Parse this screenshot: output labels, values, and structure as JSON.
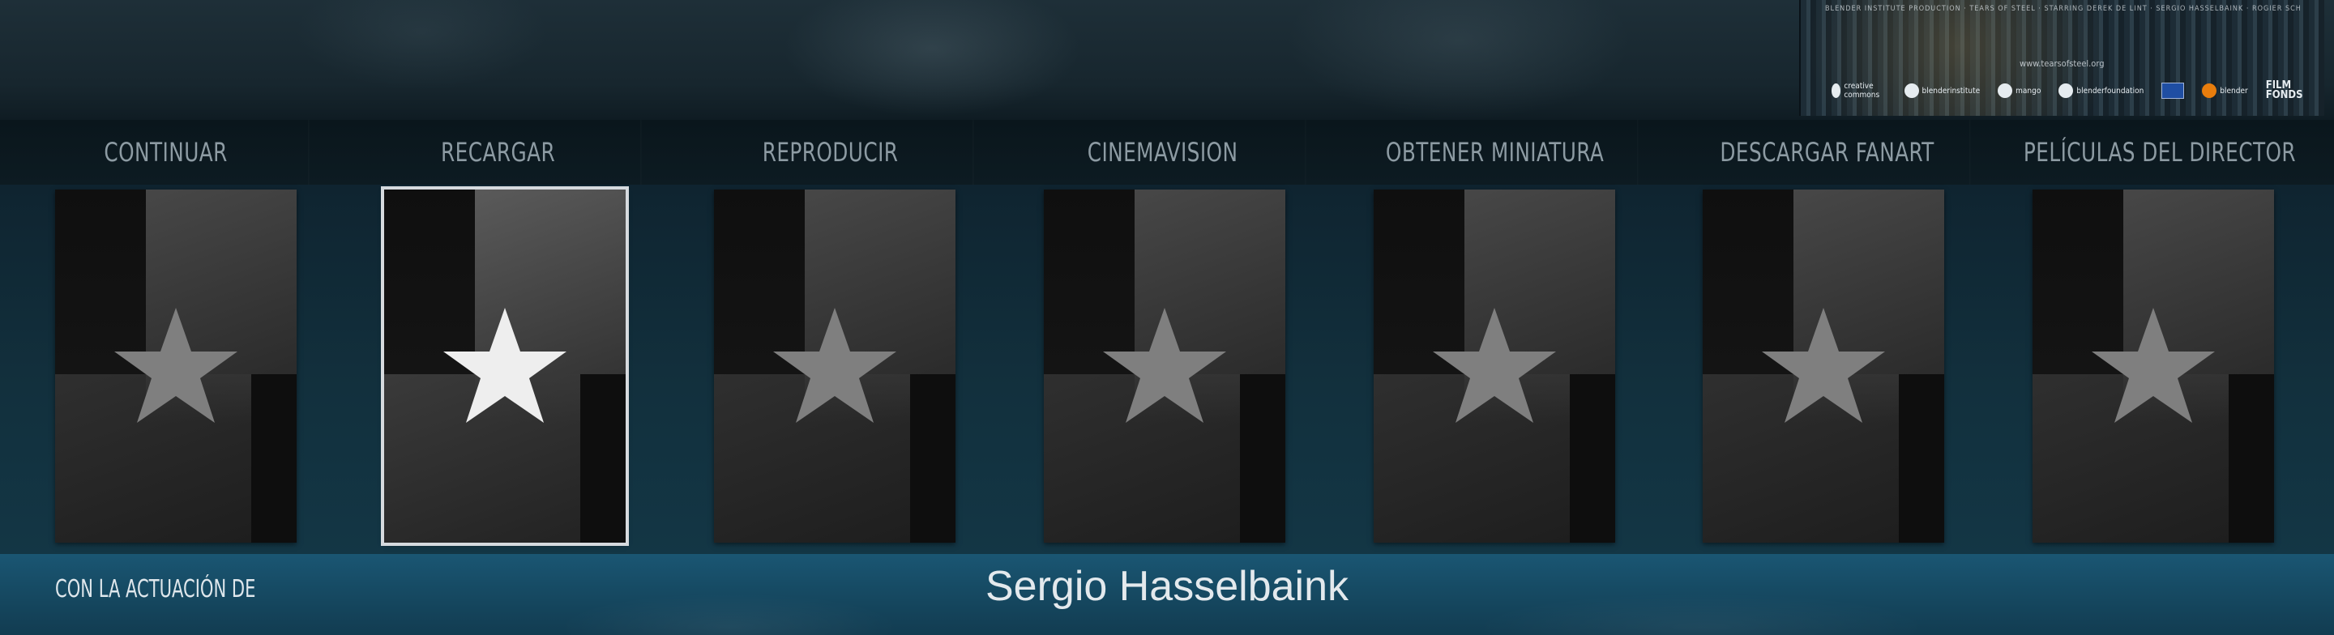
{
  "poster": {
    "credits": "Blender Institute production · Tears of Steel · starring Derek de Lint · Sergio Hasselbaink · Rogier Schippers · Vanja Rukavina · Denise Rebergen · Jody Bhe · Chris Haley · Written and directed by Ian Hubert · Produced by Ton Roosendaal · Director of photography Joris Kerbosch · Music by Joram Letwory · Costume design Paulo Lobo · Assistant director Mateusz · Art director Nicolò Giusto · Visual effects Blender Institute",
    "url": "www.tearsofsteel.org",
    "logos": [
      "creative commons",
      "blenderinstitute",
      "mango",
      "blenderfoundation",
      "EU",
      "blender",
      "FILM FONDS"
    ]
  },
  "buttons": [
    {
      "label": "CONTINUAR"
    },
    {
      "label": "RECARGAR"
    },
    {
      "label": "REPRODUCIR"
    },
    {
      "label": "CINEMAVISION"
    },
    {
      "label": "OBTENER MINIATURA"
    },
    {
      "label": "DESCARGAR FANART"
    },
    {
      "label": "PELÍCULAS DEL DIRECTOR"
    }
  ],
  "cards": [
    {
      "icon": "star-icon",
      "focused": false
    },
    {
      "icon": "star-icon",
      "focused": true
    },
    {
      "icon": "star-icon",
      "focused": false
    },
    {
      "icon": "star-icon",
      "focused": false
    },
    {
      "icon": "star-icon",
      "focused": false
    },
    {
      "icon": "star-icon",
      "focused": false
    },
    {
      "icon": "star-icon",
      "focused": false
    }
  ],
  "info": {
    "label": "CON LA ACTUACIÓN DE",
    "value": "Sergio Hasselbaink"
  },
  "colors": {
    "star": "#7f7f7f",
    "star_focused": "#eeeeee",
    "focus_border": "#d6dade",
    "info_bar": "#1a5673"
  }
}
